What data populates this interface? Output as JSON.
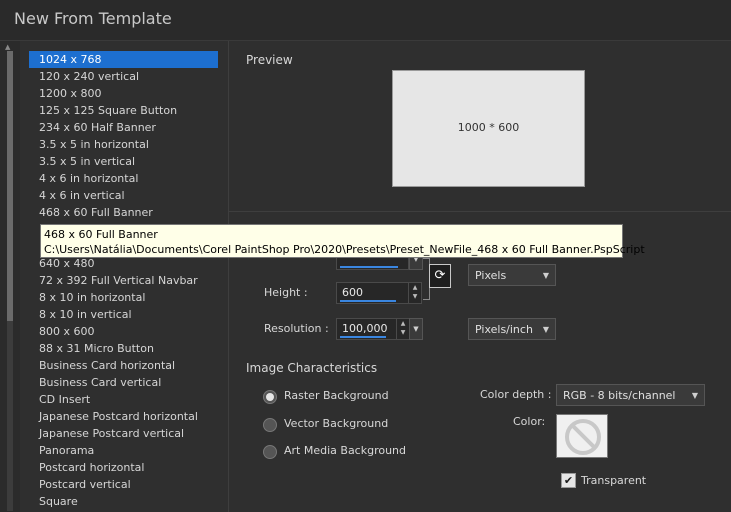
{
  "window": {
    "title": "New From Template"
  },
  "templates": [
    "1024 x 768",
    "120 x 240 vertical",
    "1200 x 800",
    "125 x 125 Square Button",
    "234 x 60 Half Banner",
    "3.5 x 5 in horizontal",
    "3.5 x 5 in vertical",
    "4 x 6 in horizontal",
    "4 x 6 in vertical",
    "468 x 60 Full Banner",
    "",
    "",
    "640 x 480",
    "72 x 392 Full Vertical Navbar",
    "8 x 10 in horizontal",
    "8 x 10 in vertical",
    "800 x 600",
    "88 x 31 Micro Button",
    "Business Card horizontal",
    "Business Card vertical",
    "CD Insert",
    "Japanese Postcard horizontal",
    "Japanese Postcard vertical",
    "Panorama",
    "Postcard horizontal",
    "Postcard vertical",
    "Square"
  ],
  "tooltip": {
    "name": "468 x 60 Full Banner",
    "path": "C:\\Users\\Natália\\Documents\\Corel PaintShop Pro\\2020\\Presets\\Preset_NewFile_468 x 60 Full Banner.PspScript"
  },
  "preview": {
    "label": "Preview",
    "text": "1000 * 600"
  },
  "dimensions": {
    "height_label": "Height :",
    "height_value": "600",
    "resolution_label": "Resolution :",
    "resolution_value": "100,000",
    "units_value": "Pixels",
    "res_units_value": "Pixels/inch"
  },
  "image_characteristics": {
    "title": "Image Characteristics",
    "raster": "Raster Background",
    "vector": "Vector Background",
    "art_media": "Art Media Background",
    "color_depth_label": "Color depth :",
    "color_depth_value": "RGB - 8 bits/channel",
    "color_label": "Color:",
    "transparent_label": "Transparent"
  },
  "icons": {
    "link": "link-icon",
    "no_color": "no-color-icon"
  },
  "colors": {
    "selection": "#1d6fd0",
    "tooltip_bg": "#ffffe8"
  }
}
